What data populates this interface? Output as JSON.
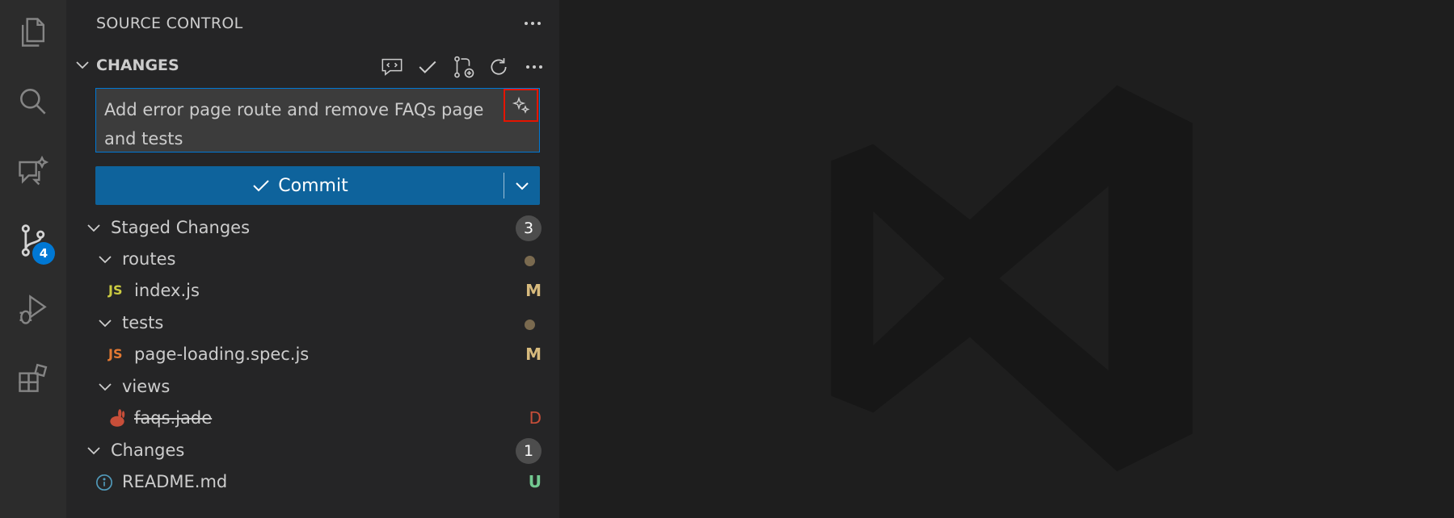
{
  "sidebar": {
    "title": "SOURCE CONTROL",
    "section_label": "CHANGES",
    "commit_message": "Add error page route and remove FAQs page and tests",
    "commit_label": "Commit"
  },
  "activity": {
    "scm_badge": "4"
  },
  "staged": {
    "label": "Staged Changes",
    "count": "3",
    "folders": [
      {
        "name": "routes",
        "file": "index.js",
        "file_icon": "JS",
        "status": "M"
      },
      {
        "name": "tests",
        "file": "page-loading.spec.js",
        "file_icon": "JS",
        "status": "M"
      },
      {
        "name": "views",
        "file": "faqs.jade",
        "status": "D"
      }
    ]
  },
  "changes": {
    "label": "Changes",
    "count": "1",
    "file": "README.md",
    "status": "U"
  },
  "colors": {
    "accent": "#0078d4",
    "commit_button": "#0e639c",
    "modified": "#d7ba7d",
    "deleted": "#c74e39",
    "untracked": "#73c991",
    "highlight_border": "#e51400"
  }
}
